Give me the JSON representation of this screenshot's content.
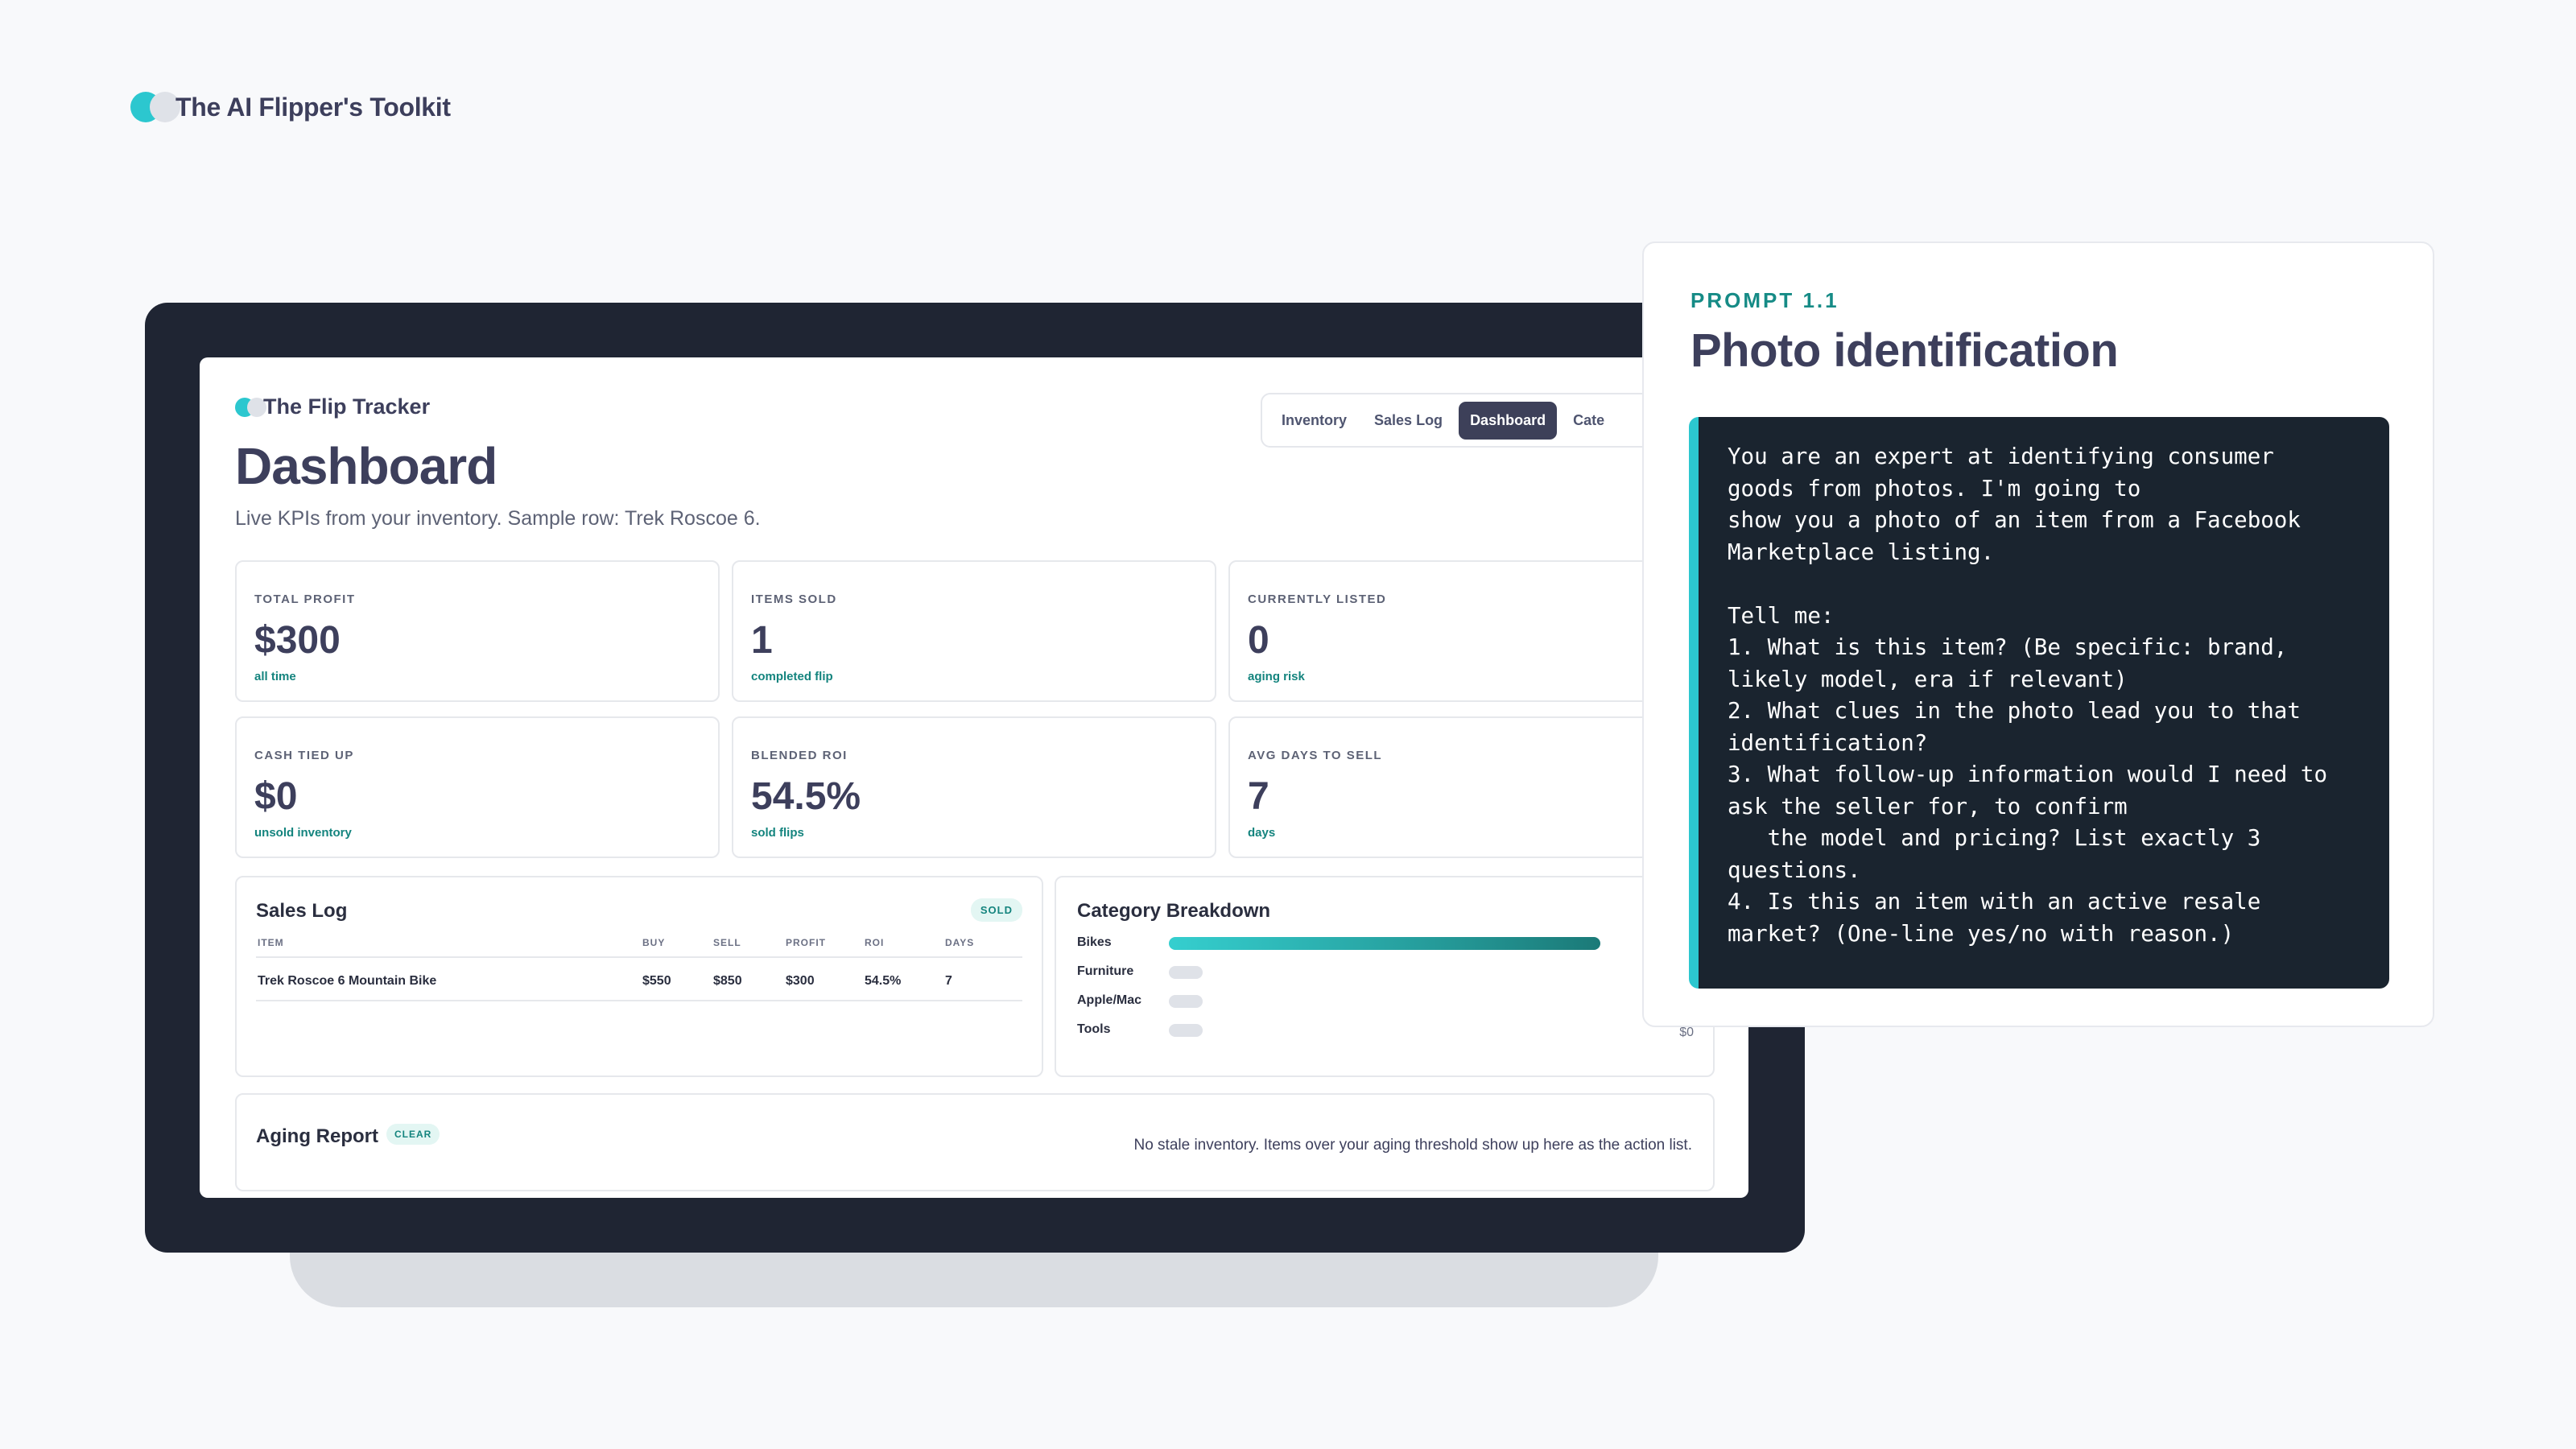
{
  "brand": {
    "title": "The AI Flipper's Toolkit"
  },
  "app": {
    "name": "The Flip Tracker",
    "tabs": [
      {
        "label": "Inventory",
        "active": false
      },
      {
        "label": "Sales Log",
        "active": false
      },
      {
        "label": "Dashboard",
        "active": true
      },
      {
        "label": "Cate",
        "active": false
      }
    ],
    "page_title": "Dashboard",
    "subtitle": "Live KPIs from your inventory. Sample row: Trek Roscoe 6.",
    "kpis": [
      {
        "label": "TOTAL PROFIT",
        "value": "$300",
        "sub": "all time"
      },
      {
        "label": "ITEMS SOLD",
        "value": "1",
        "sub": "completed flip"
      },
      {
        "label": "CURRENTLY LISTED",
        "value": "0",
        "sub": "aging risk"
      },
      {
        "label": "CASH TIED UP",
        "value": "$0",
        "sub": "unsold inventory"
      },
      {
        "label": "BLENDED ROI",
        "value": "54.5%",
        "sub": "sold flips"
      },
      {
        "label": "AVG DAYS TO SELL",
        "value": "7",
        "sub": "days"
      }
    ],
    "sales_log": {
      "title": "Sales Log",
      "badge": "SOLD",
      "columns": [
        "ITEM",
        "BUY",
        "SELL",
        "PROFIT",
        "ROI",
        "DAYS"
      ],
      "rows": [
        [
          "Trek Roscoe 6 Mountain Bike",
          "$550",
          "$850",
          "$300",
          "54.5%",
          "7"
        ]
      ]
    },
    "category_breakdown": {
      "title": "Category Breakdown",
      "categories": [
        {
          "label": "Bikes",
          "fraction": 1.0
        },
        {
          "label": "Furniture",
          "fraction": 0
        },
        {
          "label": "Apple/Mac",
          "fraction": 0
        },
        {
          "label": "Tools",
          "fraction": 0,
          "amount": "$0"
        }
      ]
    },
    "aging_report": {
      "title": "Aging Report",
      "badge": "CLEAR",
      "message": "No stale inventory. Items over your aging threshold show up here as the action list."
    }
  },
  "prompt_card": {
    "eyebrow": "PROMPT 1.1",
    "title": "Photo identification",
    "body": "You are an expert at identifying consumer\ngoods from photos. I'm going to\nshow you a photo of an item from a Facebook\nMarketplace listing.\n\nTell me:\n1. What is this item? (Be specific: brand,\nlikely model, era if relevant)\n2. What clues in the photo lead you to that\nidentification?\n3. What follow-up information would I need to\nask the seller for, to confirm\n   the model and pricing? List exactly 3\nquestions.\n4. Is this an item with an active resale\nmarket? (One-line yes/no with reason.)"
  },
  "colors": {
    "accent_teal": "#2cc7cf",
    "accent_dark_teal": "#14847e",
    "laptop_frame": "#1f2533",
    "code_bg": "#1a242f",
    "active_tab": "#3d4059"
  }
}
